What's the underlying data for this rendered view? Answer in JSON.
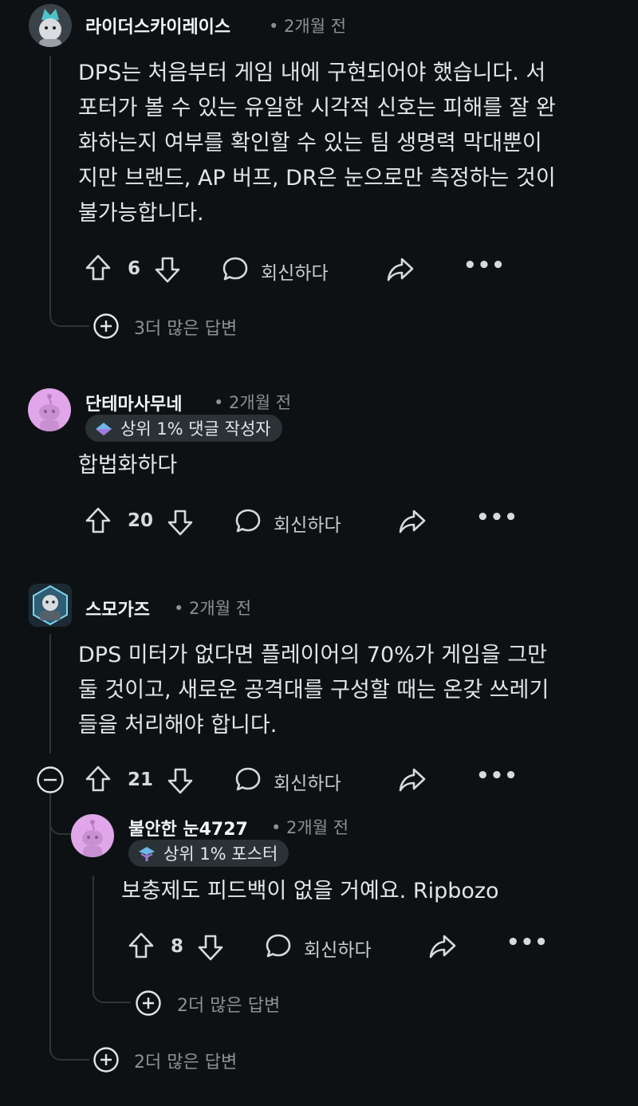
{
  "comments": [
    {
      "author": "라이더스카이레이스",
      "time": "• 2개월 전",
      "lines": [
        "DPS는 처음부터 게임 내에 구현되어야 했습니다. 서",
        "포터가 볼 수 있는 유일한 시각적 신호는 피해를 잘 완",
        "화하는지 여부를 확인할 수 있는 팀 생명력 막대뿐이",
        "지만 브랜드, AP 버프, DR은 눈으로만 측정하는 것이",
        "불가능합니다."
      ],
      "votes": "6",
      "reply": "회신하다",
      "more_replies": "3더 많은 답변"
    },
    {
      "author": "단테마사무네",
      "time": "• 2개월 전",
      "flair": "상위 1% 댓글 작성자",
      "lines": [
        "합법화하다"
      ],
      "votes": "20",
      "reply": "회신하다"
    },
    {
      "author": "스모가즈",
      "time": "• 2개월 전",
      "lines": [
        "DPS 미터가 없다면 플레이어의 70%가 게임을 그만",
        "둘 것이고, 새로운 공격대를 구성할 때는 온갖 쓰레기",
        "들을 처리해야 합니다."
      ],
      "votes": "21",
      "reply": "회신하다",
      "more_replies": "2더 많은 답변"
    },
    {
      "author": "불안한 눈4727",
      "time": "• 2개월 전",
      "flair": "상위 1% 포스터",
      "lines": [
        "보충제도 피드백이 없을 거예요. Ripbozo"
      ],
      "votes": "8",
      "reply": "회신하다",
      "more_replies": "2더 많은 답변"
    }
  ],
  "colors": {
    "background": "#0e1113",
    "thread_line": "#2f3437",
    "flair_bg": "#2a3236",
    "avatar_pink": "#e1a6e9"
  },
  "icons": [
    "upvote-icon",
    "downvote-icon",
    "reply-bubble-icon",
    "share-icon",
    "more-dots-icon",
    "expand-plus-icon",
    "collapse-minus-icon",
    "flair-badge-icon"
  ]
}
